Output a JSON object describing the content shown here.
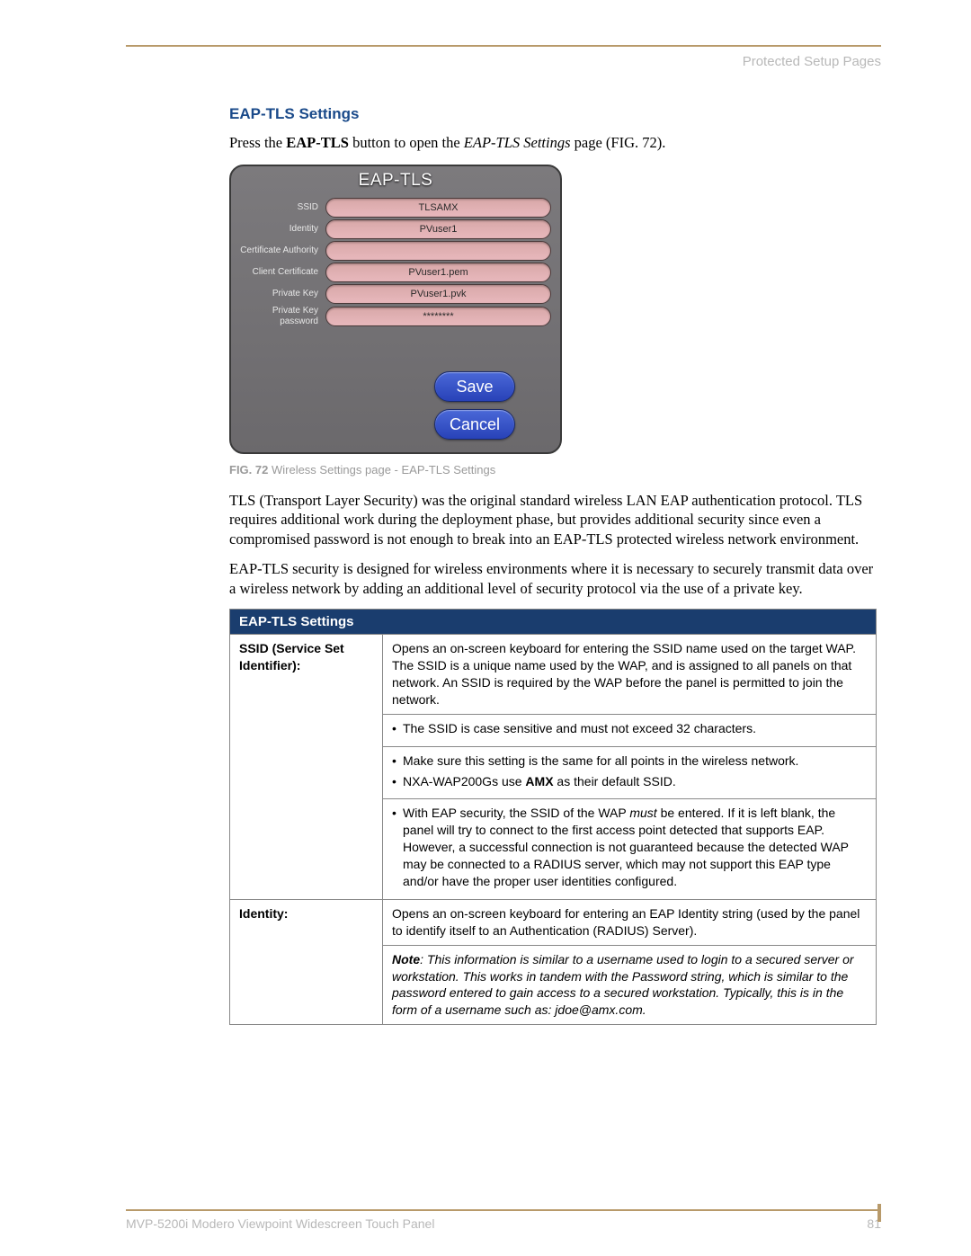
{
  "header": {
    "right": "Protected Setup Pages"
  },
  "section": {
    "title": "EAP-TLS Settings"
  },
  "intro": {
    "prefix": "Press the ",
    "bold": "EAP-TLS",
    "mid": " button to open the ",
    "ital": "EAP-TLS Settings",
    "suffix": " page (FIG. 72)."
  },
  "screenshot": {
    "title": "EAP-TLS",
    "fields": [
      {
        "label": "SSID",
        "value": "TLSAMX"
      },
      {
        "label": "Identity",
        "value": "PVuser1"
      },
      {
        "label": "Certificate Authority",
        "value": ""
      },
      {
        "label": "Client Certificate",
        "value": "PVuser1.pem"
      },
      {
        "label": "Private Key",
        "value": "PVuser1.pvk"
      },
      {
        "label": "Private Key password",
        "value": "********"
      }
    ],
    "save": "Save",
    "cancel": "Cancel"
  },
  "figcap": {
    "label": "FIG. 72",
    "text": "  Wireless Settings page - EAP-TLS Settings"
  },
  "para1": "TLS (Transport Layer Security) was the original standard wireless LAN EAP authentication protocol. TLS requires additional work during the deployment phase, but provides additional security since even a compromised password is not enough to break into an EAP-TLS protected wireless network environment.",
  "para2": "EAP-TLS security is designed for wireless environments where it is necessary to securely transmit data over a wireless network by adding an additional level of security protocol via the use of a private key.",
  "table": {
    "header": "EAP-TLS Settings",
    "rows": {
      "ssid": {
        "label": "SSID (Service Set Identifier):",
        "d1": "Opens an on-screen keyboard for entering the SSID name used on the target WAP. The SSID is a unique name used by the WAP, and is assigned to all panels on that network. An SSID is required by the WAP before the panel is permitted to join the network.",
        "b1": "The SSID is case sensitive and must not exceed 32 characters.",
        "b2": "Make sure this setting is the same for all points in the wireless network.",
        "b3a": "NXA-WAP200Gs use ",
        "b3b": "AMX",
        "b3c": " as their default SSID.",
        "b4a": "With EAP security, the SSID of the WAP ",
        "b4b": "must",
        "b4c": " be entered. If it is left blank, the panel will try to connect to the first access point detected that supports EAP. However, a successful connection is not guaranteed because the detected WAP may be connected to a RADIUS server, which may not support this EAP type and/or have the proper user identities configured."
      },
      "identity": {
        "label": "Identity:",
        "d1": "Opens an on-screen keyboard for entering an EAP Identity string (used by the panel to identify itself to an Authentication (RADIUS) Server).",
        "n1a": "Note",
        "n1b": ": This information is similar to a username used to login to a secured server or workstation. This works in tandem with the Password string, which is similar to the password entered to gain access to a secured workstation. Typically, this is in the form of a username such as: jdoe@amx.com."
      }
    }
  },
  "footer": {
    "left": "MVP-5200i Modero Viewpoint Widescreen Touch Panel",
    "right": "81"
  }
}
